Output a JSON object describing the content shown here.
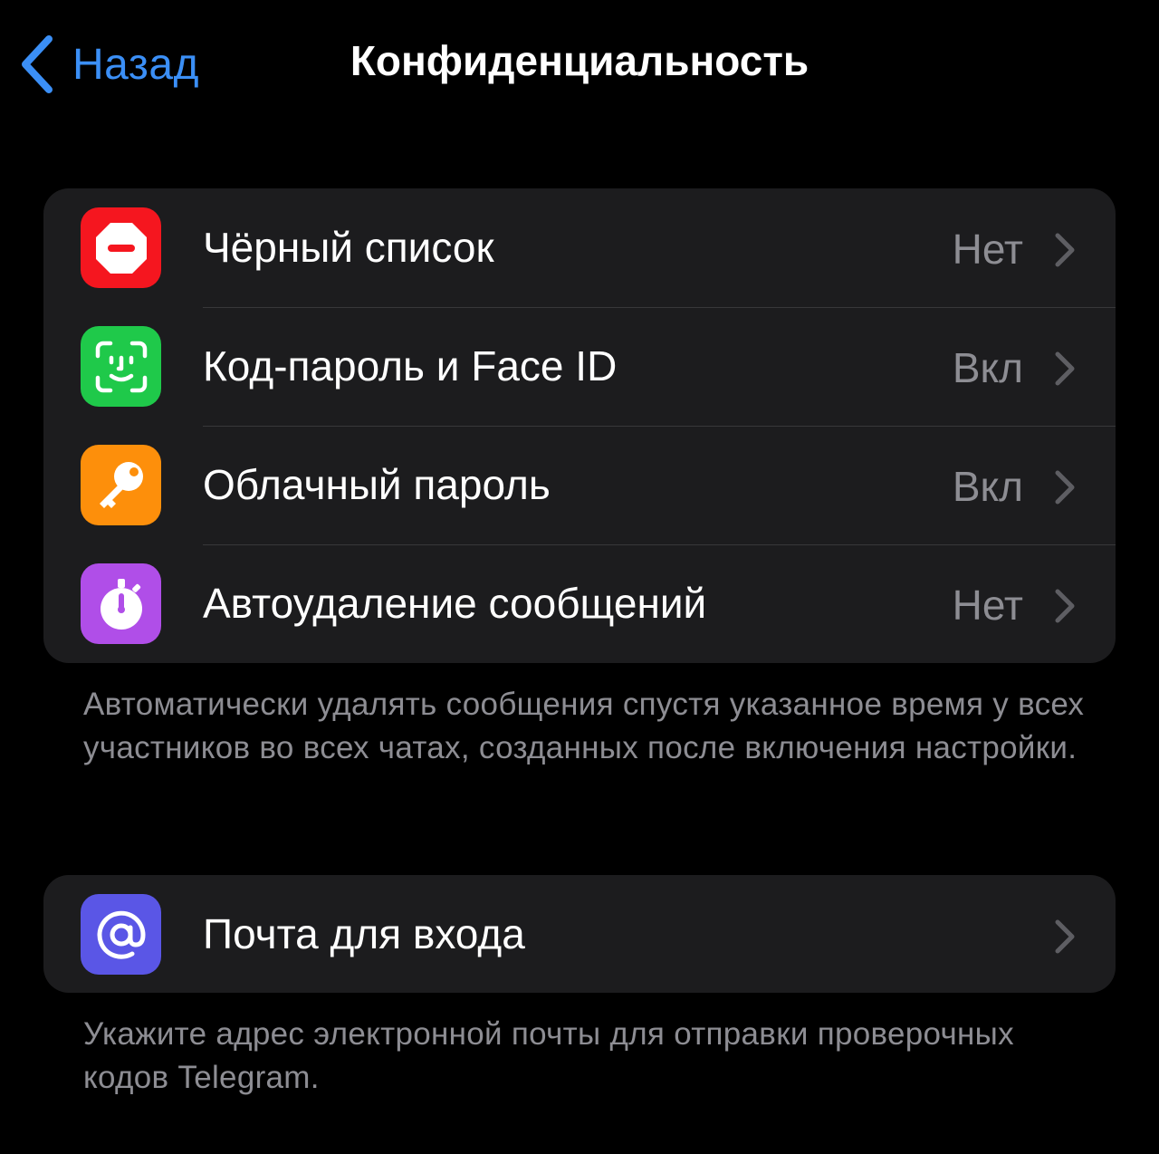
{
  "nav": {
    "back_label": "Назад",
    "title": "Конфиденциальность"
  },
  "groups": [
    {
      "rows": [
        {
          "label": "Чёрный список",
          "value": "Нет",
          "icon": "blocked-icon",
          "color": "#f5161f"
        },
        {
          "label": "Код-пароль и Face ID",
          "value": "Вкл",
          "icon": "face-id-icon",
          "color": "#1fc94a"
        },
        {
          "label": "Облачный пароль",
          "value": "Вкл",
          "icon": "key-icon",
          "color": "#fd8f0b"
        },
        {
          "label": "Автоудаление сообщений",
          "value": "Нет",
          "icon": "timer-icon",
          "color": "#b04ee8"
        }
      ],
      "footnote": "Автоматически удалять сообщения спустя указанное время у всех участников во всех чатах, созданных после включения настройки."
    },
    {
      "rows": [
        {
          "label": "Почта для входа",
          "value": "",
          "icon": "at-sign-icon",
          "color": "#5a56e6"
        }
      ],
      "footnote": "Укажите адрес электронной почты для отправки проверочных кодов Telegram."
    }
  ],
  "colors": {
    "background": "#000000",
    "cell": "#1c1c1e",
    "accent": "#3b8ff6",
    "secondary_text": "#8d8d93",
    "separator": "#38383a"
  }
}
